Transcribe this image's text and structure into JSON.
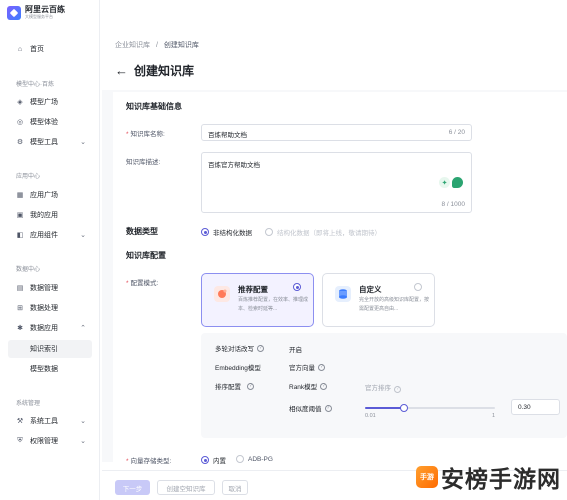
{
  "brand": {
    "title": "阿里云百练",
    "subtitle": "大模型服务平台"
  },
  "sidebar": {
    "home": "首页",
    "groups": {
      "model": "模型中心·百炼",
      "app": "应用中心",
      "data": "数据中心",
      "system": "系统管理"
    },
    "model_items": [
      "模型广场",
      "模型体验",
      "模型工具"
    ],
    "app_items": [
      "应用广场",
      "我的应用",
      "应用组件"
    ],
    "data_items": [
      "数据管理",
      "数据处理",
      "数据应用"
    ],
    "data_sub": [
      "知识索引",
      "模型数据"
    ],
    "system_items": [
      "系统工具",
      "权限管理"
    ]
  },
  "breadcrumb": {
    "parent": "企业知识库",
    "sep": "/",
    "current": "创建知识库"
  },
  "page": {
    "title": "创建知识库",
    "back_icon": "arrow-left-icon"
  },
  "basic": {
    "section": "知识库基础信息",
    "name_label": "知识库名称:",
    "name_value": "百炼帮助文档",
    "name_count": "6 / 20",
    "desc_label": "知识库描述:",
    "desc_value": "百炼官方帮助文档",
    "desc_count": "8 / 1000"
  },
  "data_type": {
    "label": "数据类型",
    "option_on": "非结构化数据",
    "option_off": "结构化数据（即将上线，敬请期待）"
  },
  "kb_config": {
    "section": "知识库配置",
    "mode_label": "配置模式:",
    "recommended": {
      "title": "推荐配置",
      "desc": "百炼推荐配置，在效率、推理成本、检索时延等..."
    },
    "custom": {
      "title": "自定义",
      "desc": "完全开放的高级知识库配置，按需配置更高自由..."
    }
  },
  "advanced": {
    "multi_turn_label": "多轮对话改写",
    "multi_turn_value": "开启",
    "embedding_label": "Embedding模型",
    "embedding_value": "官方向量",
    "rank_section_label": "排序配置",
    "rank_model_label": "Rank模型",
    "rank_model_value": "官方排序",
    "threshold_label": "相似度阈值",
    "threshold_value": "0.30",
    "threshold_fraction": 0.3,
    "slider_min": "0.01",
    "slider_max": "1"
  },
  "storage": {
    "label": "向量存储类型:",
    "option_on": "内置",
    "option_off": "ADB-PG"
  },
  "footer": {
    "next": "下一步",
    "create_empty": "创建空知识库",
    "cancel": "取消"
  },
  "watermark": {
    "badge": "手游",
    "text": "安榜手游网"
  },
  "colors": {
    "accent": "#5b5bd6",
    "accent_light": "#f3f2ff",
    "required": "#e34d59"
  }
}
